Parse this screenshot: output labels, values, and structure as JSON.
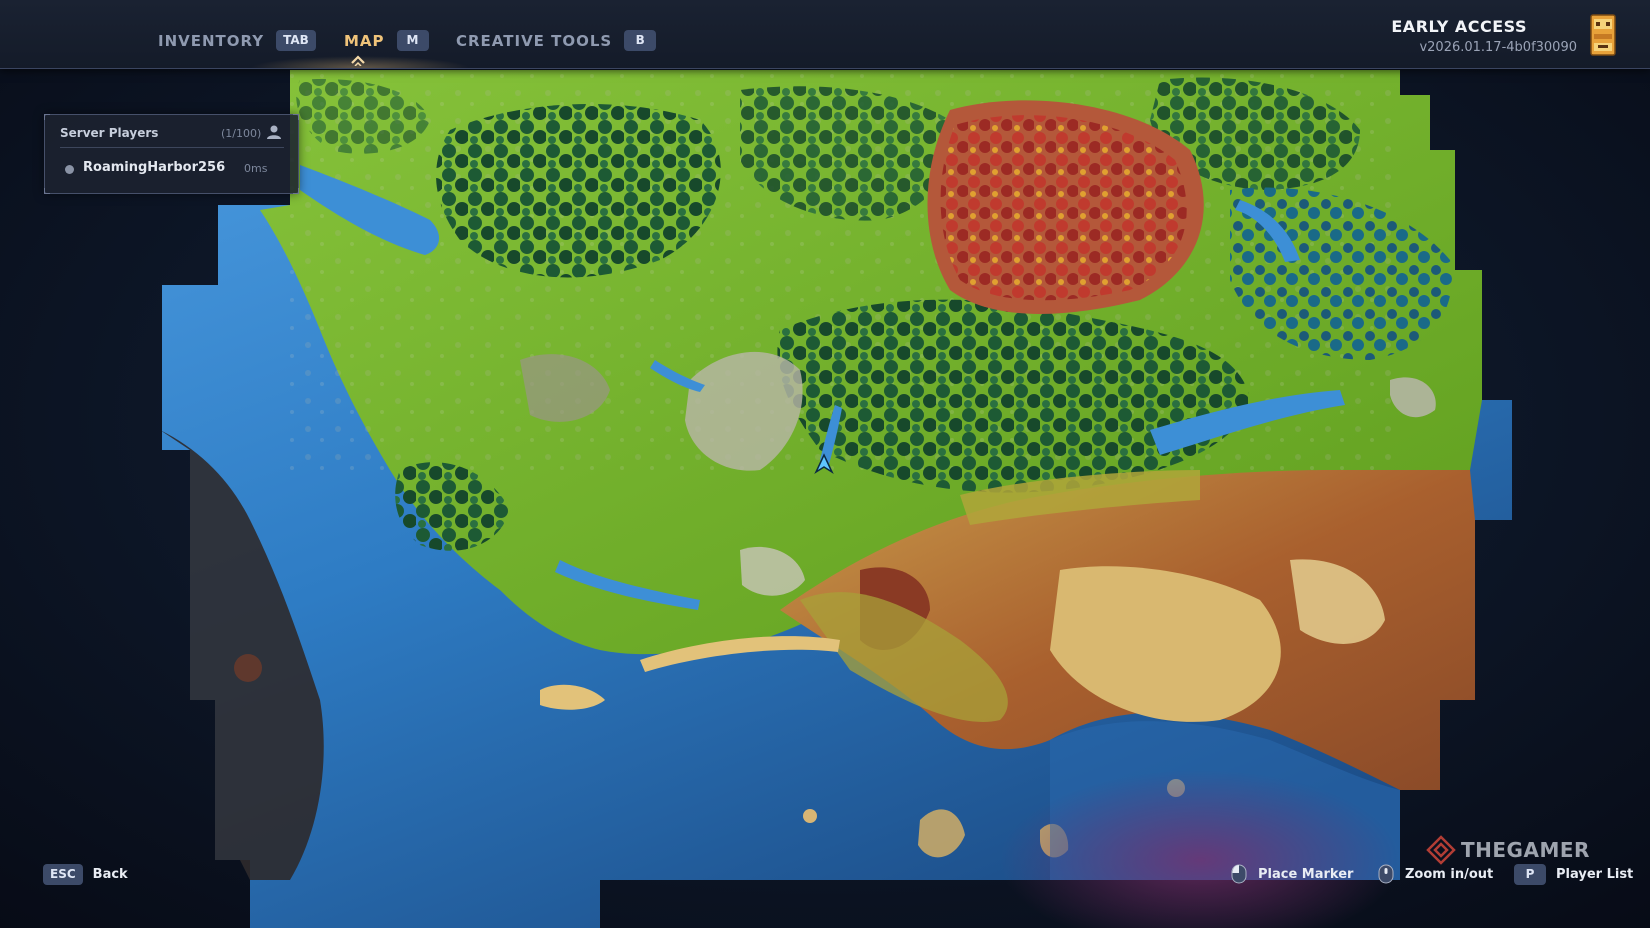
{
  "header": {
    "tabs": [
      {
        "label": "INVENTORY",
        "key": "TAB",
        "active": false
      },
      {
        "label": "MAP",
        "key": "M",
        "active": true
      },
      {
        "label": "CREATIVE TOOLS",
        "key": "B",
        "active": false
      }
    ],
    "early_access_title": "EARLY ACCESS",
    "version": "v2026.01.17-4b0f30090"
  },
  "server_players": {
    "title": "Server Players",
    "count": "(1/100)",
    "players": [
      {
        "name": "RoamingHarbor256",
        "ping": "0ms"
      }
    ]
  },
  "footer": {
    "back": {
      "key": "ESC",
      "label": "Back"
    },
    "place_marker": {
      "icon": "mouse-left-icon",
      "label": "Place Marker"
    },
    "zoom": {
      "icon": "mouse-scroll-icon",
      "label": "Zoom in/out"
    },
    "player_list": {
      "key": "P",
      "label": "Player List"
    }
  },
  "watermark": "THEGAMER",
  "colors": {
    "accent": "#efc37a",
    "ocean": "#2f7fc4",
    "grass": "#7cbb2c",
    "forest": "#1f5a36",
    "autumn": "#b63a2a",
    "desert": "#d9b870",
    "badlands": "#a6572d"
  }
}
